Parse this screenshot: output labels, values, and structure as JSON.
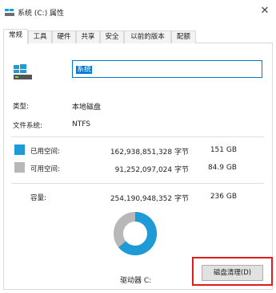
{
  "window": {
    "title": "系统 (C:) 属性",
    "close_glyph": "✕"
  },
  "tabs": [
    {
      "label": "常规",
      "active": true
    },
    {
      "label": "工具",
      "active": false
    },
    {
      "label": "硬件",
      "active": false
    },
    {
      "label": "共享",
      "active": false
    },
    {
      "label": "安全",
      "active": false
    },
    {
      "label": "以前的版本",
      "active": false
    },
    {
      "label": "配额",
      "active": false
    }
  ],
  "general": {
    "drive_name_value": "系统",
    "type_label": "类型:",
    "type_value": "本地磁盘",
    "fs_label": "文件系统:",
    "fs_value": "NTFS",
    "used": {
      "label": "已用空间:",
      "bytes": "162,938,851,328 字节",
      "size": "151 GB",
      "color": "#1e9ad6"
    },
    "free": {
      "label": "可用空间:",
      "bytes": "91,252,097,024 字节",
      "size": "84.9 GB",
      "color": "#b8b8b8"
    },
    "capacity": {
      "label": "容量:",
      "bytes": "254,190,948,352 字节",
      "size": "236 GB"
    },
    "drive_label": "驱动器 C:",
    "cleanup_button": "磁盘清理(D)"
  },
  "usage": {
    "used_fraction": 0.64
  }
}
